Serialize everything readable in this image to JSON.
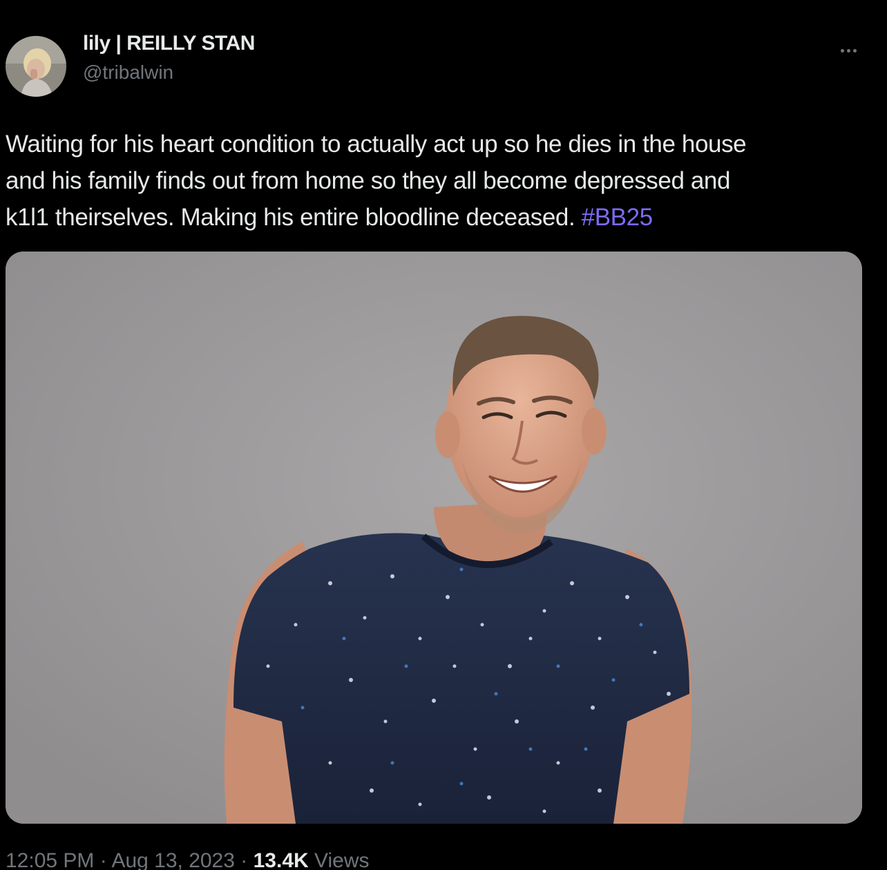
{
  "author": {
    "display_name": "lily | REILLY STAN",
    "handle": "@tribalwin",
    "avatar_icon": "user-avatar-photo"
  },
  "more_icon": "more-horizontal-icon",
  "tweet": {
    "text_lines": [
      "Waiting for his heart condition to actually act up so he dies in the house",
      "and his family finds out from home so they all become depressed and",
      "k1l1 theirselves. Making his entire bloodline deceased. "
    ],
    "hashtag": "#BB25"
  },
  "media": {
    "type": "photo",
    "background_color": "#9c9a9b",
    "shirt_color": "#1e2a44"
  },
  "meta": {
    "time": "12:05 PM",
    "separator": " · ",
    "date": "Aug 13, 2023",
    "views_count": "13.4K",
    "views_label": " Views"
  },
  "colors": {
    "background": "#000000",
    "text": "#e7e9ea",
    "secondary": "#71767b",
    "hashtag": "#7a6cf7"
  }
}
